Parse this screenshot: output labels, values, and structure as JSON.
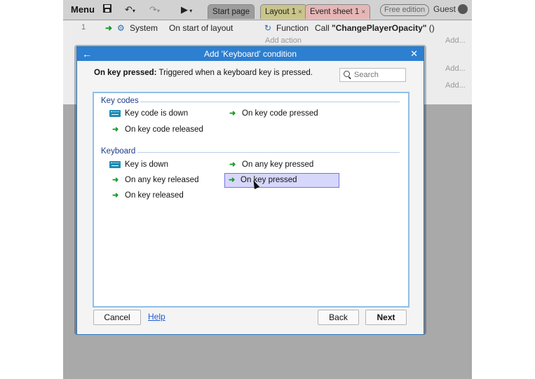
{
  "toolbar": {
    "menu_label": "Menu",
    "tabs": [
      {
        "label": "Start page"
      },
      {
        "label": "Layout 1"
      },
      {
        "label": "Event sheet 1"
      }
    ],
    "close_glyph": "×",
    "free_edition_label": "Free edition",
    "user_label": "Guest",
    "icons": [
      "save-icon",
      "undo-icon",
      "redo-icon",
      "play-icon",
      "user-icon"
    ],
    "colors": {
      "tab_start": "#9c9c9c",
      "tab_layout": "#c9c58a",
      "tab_event": "#e6b6b6"
    }
  },
  "event_sheet": {
    "row_number": "1",
    "object_label": "System",
    "condition_label": "On start of layout",
    "action_object_label": "Function",
    "action_call_prefix": "Call ",
    "action_call_name": "\"ChangePlayerOpacity\"",
    "action_call_suffix": " ()",
    "add_action_label": "Add action",
    "add_labels": [
      "Add...",
      "Add...",
      "Add..."
    ]
  },
  "dialog": {
    "title": "Add 'Keyboard' condition",
    "description_title": "On key pressed:",
    "description_text": " Triggered when a keyboard key is pressed.",
    "search_placeholder": "Search",
    "categories": [
      {
        "name": "Key codes",
        "items": [
          {
            "label": "Key code is down",
            "icon": "keyboard-icon"
          },
          {
            "label": "On key code pressed",
            "icon": "trigger-arrow-icon"
          },
          {
            "label": "On key code released",
            "icon": "trigger-arrow-icon"
          }
        ]
      },
      {
        "name": "Keyboard",
        "items": [
          {
            "label": "Key is down",
            "icon": "keyboard-icon"
          },
          {
            "label": "On any key pressed",
            "icon": "trigger-arrow-icon"
          },
          {
            "label": "On any key released",
            "icon": "trigger-arrow-icon"
          },
          {
            "label": "On key pressed",
            "icon": "trigger-arrow-icon",
            "selected": true
          },
          {
            "label": "On key released",
            "icon": "trigger-arrow-icon"
          }
        ]
      }
    ],
    "buttons": {
      "cancel": "Cancel",
      "help": "Help",
      "back": "Back",
      "next": "Next"
    },
    "colors": {
      "title_bar": "#2d7fd0",
      "selection": "#d7d7fb",
      "category_text": "#1a3c8a",
      "trigger_arrow": "#1c9a2a"
    }
  }
}
